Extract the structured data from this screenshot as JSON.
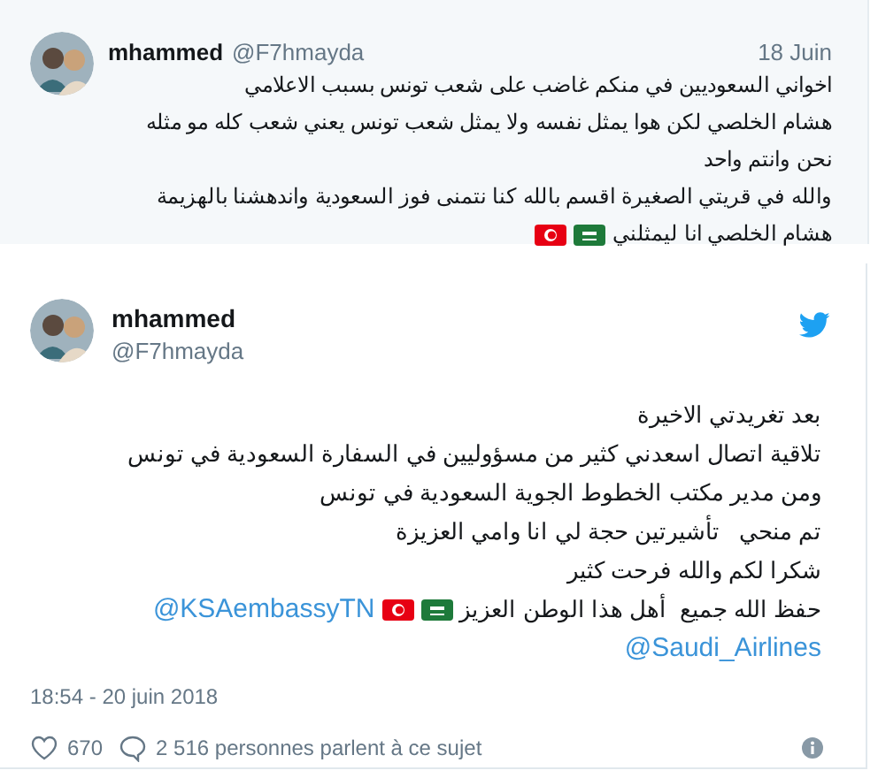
{
  "quoted_tweet": {
    "name": "mhammed",
    "handle": "@F7hmayda",
    "date": "18 Juin",
    "lines": [
      [
        {
          "kind": "text",
          "text": "اخواني السعوديين في منكم غاضب على شعب تونس بسبب الاعلامي"
        }
      ],
      [
        {
          "kind": "text",
          "text": "هشام الخلصي لكن هوا يمثل نفسه ولا يمثل شعب تونس يعني شعب كله مو مثله"
        }
      ],
      [
        {
          "kind": "text",
          "text": "نحن وانتم واحد"
        }
      ],
      [
        {
          "kind": "text",
          "text": "والله في قريتي الصغيرة اقسم بالله كنا نتمنى فوز السعودية واندهشنا بالهزيمة"
        }
      ],
      [
        {
          "kind": "text",
          "text": "هشام الخلصي انا ليمثلني"
        },
        {
          "kind": "saudi-flag"
        },
        {
          "kind": "tunisia-flag"
        }
      ]
    ]
  },
  "tweet": {
    "name": "mhammed",
    "handle": "@F7hmayda",
    "lines": [
      [
        {
          "kind": "text",
          "text": "بعد تغريدتي الاخيرة"
        }
      ],
      [
        {
          "kind": "text",
          "text": "تلاقية اتصال اسعدني كثير من مسؤوليين في السفارة السعودية في تونس"
        }
      ],
      [
        {
          "kind": "text",
          "text": "ومن مدير مكتب الخطوط الجوية السعودية في تونس"
        }
      ],
      [
        {
          "kind": "text",
          "text": "تم منحي   تأشيرتين حجة لي انا وامي العزيزة"
        }
      ],
      [
        {
          "kind": "text",
          "text": "شكرا لكم والله فرحت كثير"
        }
      ],
      [
        {
          "kind": "text",
          "text": "حفظ الله جميع  أهل هذا الوطن العزيز"
        },
        {
          "kind": "saudi-flag"
        },
        {
          "kind": "tunisia-flag"
        },
        {
          "kind": "mention",
          "text": "@KSAembassyTN"
        }
      ],
      [
        {
          "kind": "mention",
          "text": "@Saudi_Airlines"
        }
      ]
    ],
    "timestamp": "18:54 - 20 juin 2018",
    "likes": "670",
    "conversation": "2 516 personnes parlent à ce sujet"
  }
}
